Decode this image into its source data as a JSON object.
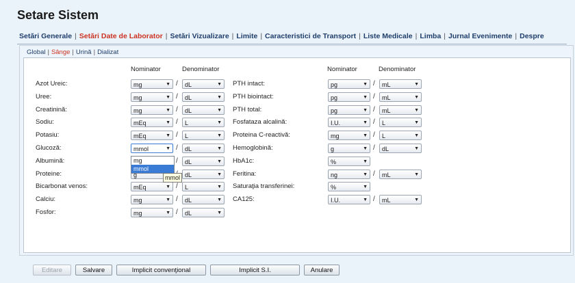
{
  "title": "Setare Sistem",
  "main_tabs": [
    {
      "label": "Setări Generale",
      "active": false
    },
    {
      "label": "Setări Date de Laborator",
      "active": true
    },
    {
      "label": "Setări Vizualizare",
      "active": false
    },
    {
      "label": "Limite",
      "active": false
    },
    {
      "label": "Caracteristici de Transport",
      "active": false
    },
    {
      "label": "Liste Medicale",
      "active": false
    },
    {
      "label": "Limba",
      "active": false
    },
    {
      "label": "Jurnal Evenimente",
      "active": false
    },
    {
      "label": "Despre",
      "active": false
    }
  ],
  "sub_tabs": [
    {
      "label": "Global",
      "active": false
    },
    {
      "label": "Sânge",
      "active": true
    },
    {
      "label": "Urină",
      "active": false
    },
    {
      "label": "Dializat",
      "active": false
    }
  ],
  "headers": {
    "nominator": "Nominator",
    "denominator": "Denominator"
  },
  "left_rows": [
    {
      "label": "Azot Ureic:",
      "nom": "mg",
      "den": "dL"
    },
    {
      "label": "Uree:",
      "nom": "mg",
      "den": "dL"
    },
    {
      "label": "Creatinină:",
      "nom": "mg",
      "den": "dL"
    },
    {
      "label": "Sodiu:",
      "nom": "mEq",
      "den": "L"
    },
    {
      "label": "Potasiu:",
      "nom": "mEq",
      "den": "L"
    },
    {
      "label": "Glucoză:",
      "nom": "mmol",
      "den": "dL"
    },
    {
      "label": "Albumină:",
      "nom": "",
      "den": "dL"
    },
    {
      "label": "Proteine:",
      "nom": "g",
      "den": "dL"
    },
    {
      "label": "Bicarbonat venos:",
      "nom": "mEq",
      "den": "L"
    },
    {
      "label": "Calciu:",
      "nom": "mg",
      "den": "dL"
    },
    {
      "label": "Fosfor:",
      "nom": "mg",
      "den": "dL"
    }
  ],
  "right_rows": [
    {
      "label": "PTH intact:",
      "nom": "pg",
      "den": "mL"
    },
    {
      "label": "PTH biointact:",
      "nom": "pg",
      "den": "mL"
    },
    {
      "label": "PTH total:",
      "nom": "pg",
      "den": "mL"
    },
    {
      "label": "Fosfataza alcalină:",
      "nom": "I.U.",
      "den": "L"
    },
    {
      "label": "Proteina C-reactivă:",
      "nom": "mg",
      "den": "L"
    },
    {
      "label": "Hemoglobină:",
      "nom": "g",
      "den": "dL"
    },
    {
      "label": "HbA1c:",
      "nom": "%",
      "den": null
    },
    {
      "label": "Feritina:",
      "nom": "ng",
      "den": "mL"
    },
    {
      "label": "Saturaţia transferinei:",
      "nom": "%",
      "den": null
    },
    {
      "label": "CA125:",
      "nom": "I.U.",
      "den": "mL"
    }
  ],
  "slash": "/",
  "dropdown_options": [
    "mg",
    "mmol"
  ],
  "tooltip": "mmol",
  "buttons": {
    "edit": "Editare",
    "save": "Salvare",
    "default_conventional": "Implicit convenţional",
    "default_si": "Implicit S.I.",
    "cancel": "Anulare"
  }
}
